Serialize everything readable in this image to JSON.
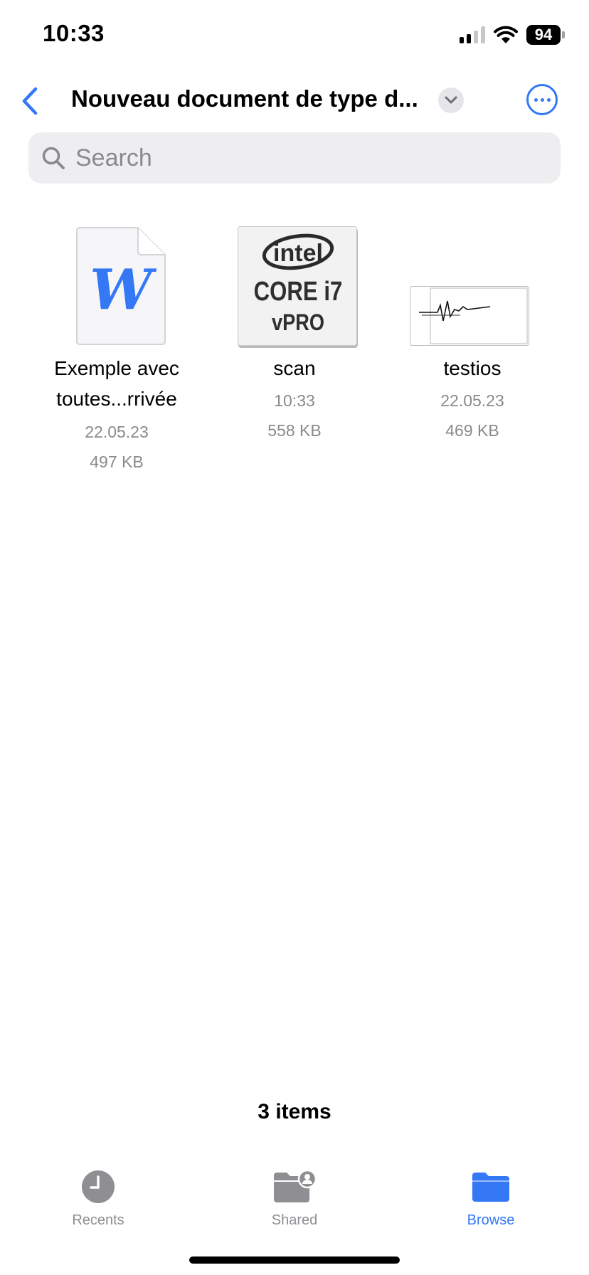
{
  "status_bar": {
    "time": "10:33",
    "battery": "94"
  },
  "nav": {
    "title": "Nouveau document de type d...",
    "accent_color": "#3478f6"
  },
  "search": {
    "placeholder": "Search",
    "value": ""
  },
  "files": [
    {
      "name_line1": "Exemple avec",
      "name_line2": "toutes...rrivée",
      "date": "22.05.23",
      "size": "497 KB",
      "thumbnail": "word-document-icon",
      "thumbnail_letter": "W"
    },
    {
      "name_line1": "scan",
      "date": "10:33",
      "size": "558 KB",
      "thumbnail": "scan-image",
      "thumbnail_text": {
        "brand": "intel",
        "line1": "CORE i7",
        "line2": "vPRO"
      }
    },
    {
      "name_line1": "testios",
      "date": "22.05.23",
      "size": "469 KB",
      "thumbnail": "signature-image"
    }
  ],
  "footer": {
    "items_count": "3 items"
  },
  "tabs": [
    {
      "label": "Recents",
      "icon": "clock-icon",
      "active": false
    },
    {
      "label": "Shared",
      "icon": "shared-folder-icon",
      "active": false
    },
    {
      "label": "Browse",
      "icon": "folder-icon",
      "active": true
    }
  ]
}
